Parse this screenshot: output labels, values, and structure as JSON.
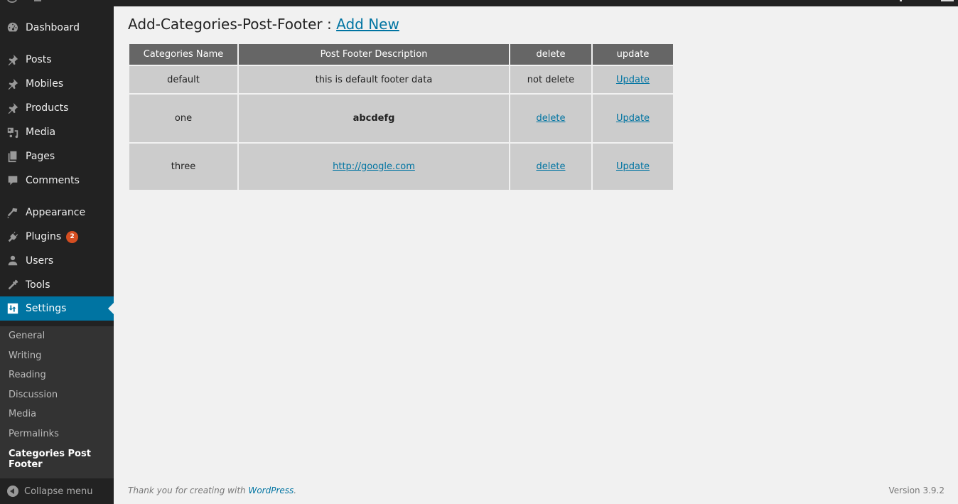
{
  "sidebar": {
    "items": [
      {
        "label": "Dashboard",
        "icon": "dashboard-icon"
      },
      {
        "label": "Posts",
        "icon": "pin-icon"
      },
      {
        "label": "Mobiles",
        "icon": "pin-icon"
      },
      {
        "label": "Products",
        "icon": "pin-icon"
      },
      {
        "label": "Media",
        "icon": "media-icon"
      },
      {
        "label": "Pages",
        "icon": "pages-icon"
      },
      {
        "label": "Comments",
        "icon": "comment-icon"
      },
      {
        "label": "Appearance",
        "icon": "brush-icon"
      },
      {
        "label": "Plugins",
        "icon": "plugin-icon",
        "badge": "2"
      },
      {
        "label": "Users",
        "icon": "user-icon"
      },
      {
        "label": "Tools",
        "icon": "wrench-icon"
      },
      {
        "label": "Settings",
        "icon": "settings-icon",
        "active": true
      }
    ],
    "submenu": [
      {
        "label": "General"
      },
      {
        "label": "Writing"
      },
      {
        "label": "Reading"
      },
      {
        "label": "Discussion"
      },
      {
        "label": "Media"
      },
      {
        "label": "Permalinks"
      },
      {
        "label": "Categories Post Footer",
        "current": true
      }
    ],
    "collapse_label": "Collapse menu"
  },
  "main": {
    "title": "Add-Categories-Post-Footer :",
    "add_new_label": "Add New",
    "table": {
      "headers": [
        "Categories Name",
        "Post Footer Description",
        "delete",
        "update"
      ],
      "rows": [
        {
          "name": "default",
          "description": "this is default footer data",
          "delete": "not delete",
          "update": "Update"
        },
        {
          "name": "one",
          "description": "abcdefg",
          "delete": "delete",
          "update": "Update"
        },
        {
          "name": "three",
          "description": "http://google.com",
          "delete": "delete",
          "update": "Update"
        }
      ]
    }
  },
  "footer": {
    "thanks_text": "Thank you for creating with",
    "wordpress_link": "WordPress",
    "thanks_suffix": ".",
    "version": "Version 3.9.2"
  },
  "colors": {
    "accent": "#0074a2",
    "sidebar_bg": "#222222",
    "submenu_bg": "#333333",
    "badge": "#d54e21",
    "table_header": "#666666",
    "table_cell": "#cccccc"
  }
}
